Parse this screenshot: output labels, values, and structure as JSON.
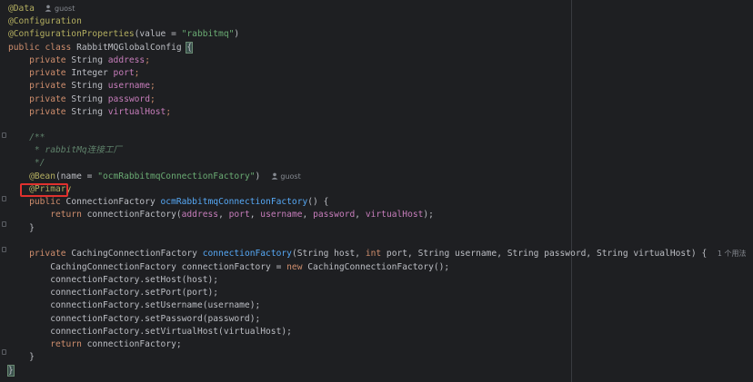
{
  "author_hint": "guost",
  "usages_hint": "1 个用法",
  "lines": {
    "l1": {
      "annotation": "@Data"
    },
    "l2": {
      "annotation": "@Configuration"
    },
    "l3": {
      "annotation": "@ConfigurationProperties",
      "open": "(",
      "param": "value",
      "eq": " = ",
      "value": "\"rabbitmq\"",
      "close": ")"
    },
    "l4": {
      "kw1": "public",
      "kw2": "class",
      "name": "RabbitMQGlobalConfig",
      "brace": "{"
    },
    "l5": {
      "kw": "private",
      "type": "String",
      "field": "address",
      "semi": ";"
    },
    "l6": {
      "kw": "private",
      "type": "Integer",
      "field": "port",
      "semi": ";"
    },
    "l7": {
      "kw": "private",
      "type": "String",
      "field": "username",
      "semi": ";"
    },
    "l8": {
      "kw": "private",
      "type": "String",
      "field": "password",
      "semi": ";"
    },
    "l9": {
      "kw": "private",
      "type": "String",
      "field": "virtualHost",
      "semi": ";"
    },
    "l10": {
      "doc": "/**"
    },
    "l11": {
      "doc": " * rabbitMq连接工厂"
    },
    "l12": {
      "doc": " */"
    },
    "l13": {
      "annotation": "@Bean",
      "open": "(",
      "param": "name",
      "eq": " = ",
      "value": "\"ocmRabbitmqConnectionFactory\"",
      "close": ")"
    },
    "l14": {
      "annotation": "@Primary"
    },
    "l15": {
      "kw": "public",
      "type": "ConnectionFactory",
      "method": "ocmRabbitmqConnectionFactory",
      "rest": "() {"
    },
    "l16": {
      "kw": "return",
      "call": "connectionFactory(",
      "a1": "address",
      "a2": "port",
      "a3": "username",
      "a4": "password",
      "a5": "virtualHost",
      "end": ");"
    },
    "l17": {
      "text": "}"
    },
    "l18": {
      "kw": "private",
      "type": "CachingConnectionFactory",
      "method": "connectionFactory",
      "sig1": "(String host, ",
      "int": "int",
      "sig2": " port, String username, String password, String virtualHost) {"
    },
    "l19": {
      "pre": "CachingConnectionFactory connectionFactory = ",
      "kw": "new",
      "post": " CachingConnectionFactory();"
    },
    "l20": {
      "text": "connectionFactory.setHost(host);"
    },
    "l21": {
      "text": "connectionFactory.setPort(port);"
    },
    "l22": {
      "text": "connectionFactory.setUsername(username);"
    },
    "l23": {
      "text": "connectionFactory.setPassword(password);"
    },
    "l24": {
      "text": "connectionFactory.setVirtualHost(virtualHost);"
    },
    "l25": {
      "kw": "return",
      "rest": " connectionFactory;"
    },
    "l26": {
      "text": "}"
    },
    "l27": {
      "text": "}"
    }
  },
  "colors": {
    "highlight_border": "#e0312e",
    "annotation": "#b3ae60",
    "keyword": "#cf8e6d",
    "field": "#c77dbb",
    "string": "#6aab73",
    "method": "#56a8f5"
  }
}
